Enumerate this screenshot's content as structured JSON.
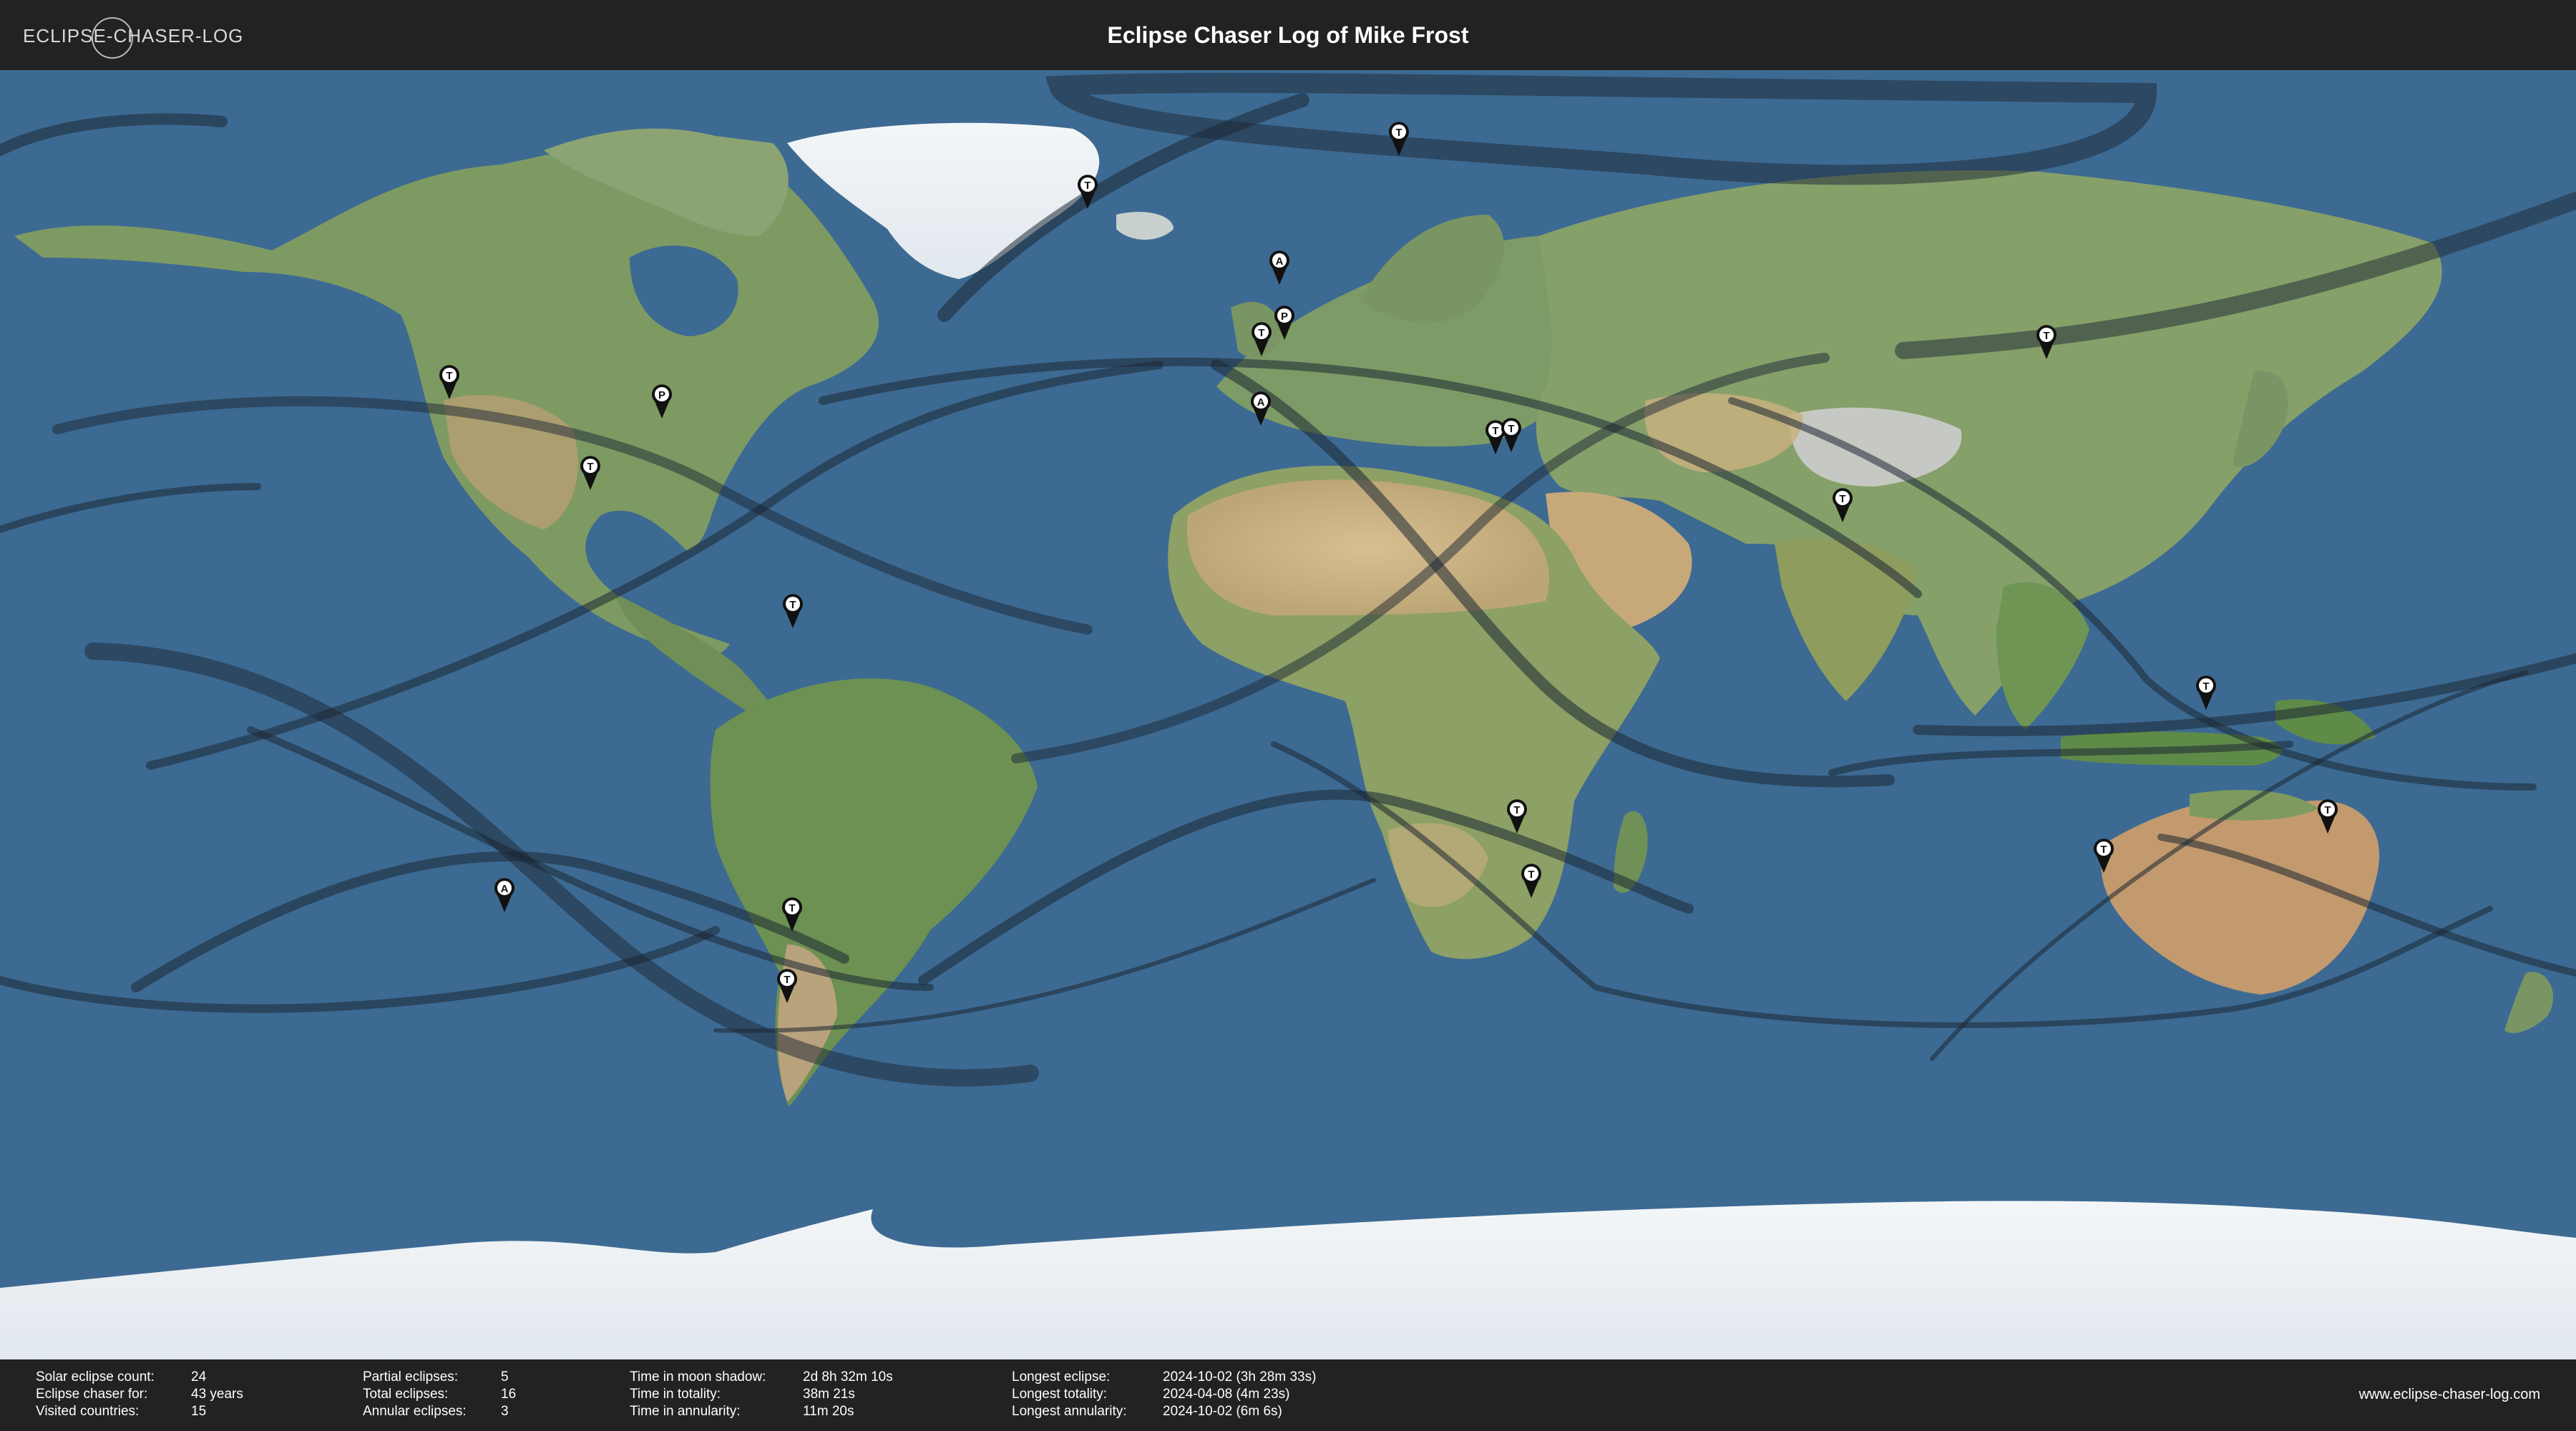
{
  "header": {
    "logo_text": "ECLIPSE-CHASER-LOG",
    "title": "Eclipse Chaser Log of Mike Frost"
  },
  "colors": {
    "ocean": "#3d6a92",
    "bar": "#222222",
    "land": "#7e9a63",
    "desert": "#c8b58a",
    "ice": "#e9eef2",
    "path": "#1c2633"
  },
  "markers": [
    {
      "type": "T",
      "place": "Greenland"
    },
    {
      "type": "T",
      "place": "Svalbard"
    },
    {
      "type": "A",
      "place": "Faroe Islands"
    },
    {
      "type": "P",
      "place": "England"
    },
    {
      "type": "T",
      "place": "England"
    },
    {
      "type": "T",
      "place": "Oregon"
    },
    {
      "type": "P",
      "place": "Michigan"
    },
    {
      "type": "T",
      "place": "Texas"
    },
    {
      "type": "A",
      "place": "Spain"
    },
    {
      "type": "T",
      "place": "Turkey"
    },
    {
      "type": "T",
      "place": "Turkey"
    },
    {
      "type": "T",
      "place": "Mongolia"
    },
    {
      "type": "T",
      "place": "India"
    },
    {
      "type": "T",
      "place": "Aruba"
    },
    {
      "type": "T",
      "place": "Indonesia"
    },
    {
      "type": "T",
      "place": "Australia"
    },
    {
      "type": "T",
      "place": "Australia"
    },
    {
      "type": "T",
      "place": "Zambia"
    },
    {
      "type": "T",
      "place": "Mozambique"
    },
    {
      "type": "A",
      "place": "Pacific Ocean"
    },
    {
      "type": "T",
      "place": "Chile"
    },
    {
      "type": "T",
      "place": "Argentina"
    }
  ],
  "stats": {
    "col1": [
      {
        "label": "Solar eclipse count:",
        "value": "24"
      },
      {
        "label": "Eclipse chaser for:",
        "value": "43 years"
      },
      {
        "label": "Visited countries:",
        "value": "15"
      }
    ],
    "col2": [
      {
        "label": "Partial eclipses:",
        "value": "5"
      },
      {
        "label": "Total eclipses:",
        "value": "16"
      },
      {
        "label": "Annular eclipses:",
        "value": "3"
      }
    ],
    "col3": [
      {
        "label": "Time in moon shadow:",
        "value": "2d 8h 32m 10s"
      },
      {
        "label": "Time in totality:",
        "value": "38m 21s"
      },
      {
        "label": "Time in annularity:",
        "value": "11m 20s"
      }
    ],
    "col4": [
      {
        "label": "Longest eclipse:",
        "value": "2024-10-02 (3h 28m 33s)"
      },
      {
        "label": "Longest totality:",
        "value": "2024-04-08 (4m 23s)"
      },
      {
        "label": "Longest annularity:",
        "value": "2024-10-02 (6m 6s)"
      }
    ],
    "website": "www.eclipse-chaser-log.com"
  }
}
